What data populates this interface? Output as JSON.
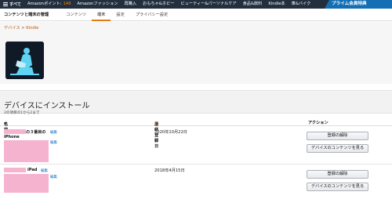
{
  "topnav": {
    "all_label": "すべて",
    "points_label": "Amazonポイント:",
    "points_value": "148",
    "items": [
      "Amazonファッション",
      "再購入",
      "おもちゃ&ホビー",
      "ビューティー&パーソナルケア",
      "食品&飲料",
      "Kindle本",
      "車&バイク"
    ],
    "prime_label": "プライム会員特典"
  },
  "subtabs": {
    "title": "コンテンツと端末の管理",
    "tabs": [
      "コンテンツ",
      "端末",
      "設定",
      "プライバシー設定"
    ],
    "active_tab": "端末"
  },
  "breadcrumb": {
    "root": "デバイス",
    "separator": ">",
    "current": "Kindle"
  },
  "section": {
    "title": "デバイスにインストール",
    "count_text": "2の項目の1から2まで",
    "columns": {
      "name": "名前",
      "name_sort": "▾",
      "registered": "最終登録日",
      "registered_sort": "▴",
      "action": "アクション"
    }
  },
  "devices": [
    {
      "name_suffix": "の３番目の",
      "name_line2": "iPhone",
      "edit": "編集",
      "edit2": "編集",
      "date": "2020年10月22日",
      "deregister": "登録の解除",
      "view_content": "デバイスのコンテンツを見る"
    },
    {
      "name_suffix": "iPad",
      "edit": "編集",
      "edit2": "編集",
      "date": "2018年4月15日",
      "deregister": "登録の解除",
      "view_content": "デバイスのコンテンツを見る"
    }
  ],
  "colors": {
    "nav_bg": "#232f3e",
    "prime_bg": "#146eb4",
    "accent": "#e47911",
    "redaction": "#f6b3cf",
    "link": "#0066c0"
  }
}
